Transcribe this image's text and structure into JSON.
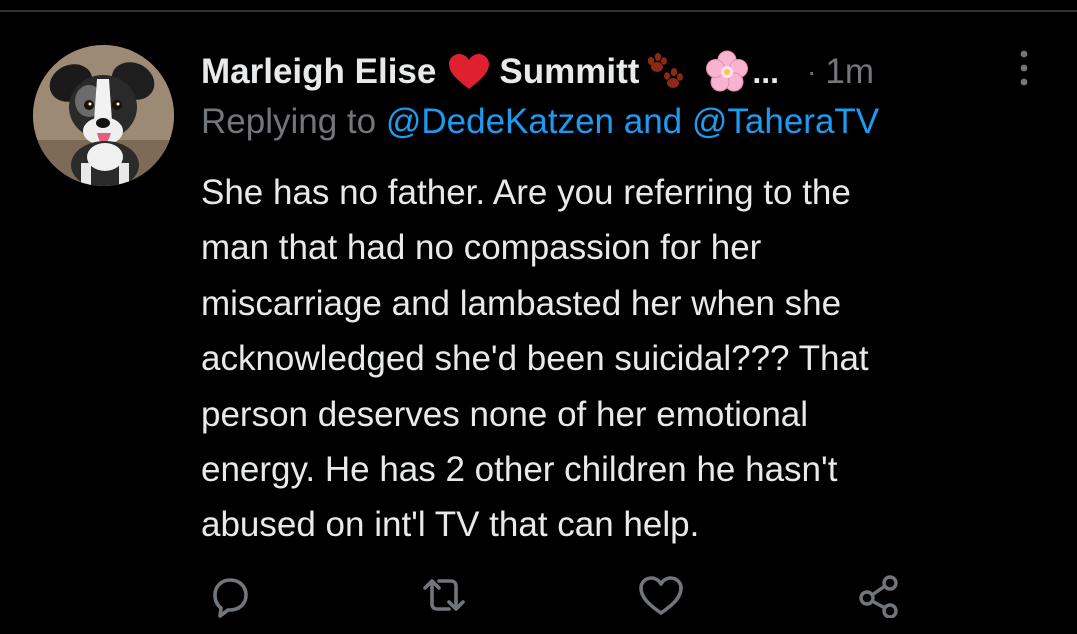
{
  "tweet": {
    "author": {
      "name_part1": "Marleigh Elise",
      "name_part2": "Summitt",
      "ellipsis": "...",
      "avatar_icon": "dog-avatar"
    },
    "time": "1m",
    "time_separator": "·",
    "replying": {
      "prefix": "Replying to ",
      "handle1": "@DedeKatzen",
      "conjunction": " and ",
      "handle2": "@TaheraTV"
    },
    "body_lines": [
      "She has no father. Are you referring to the",
      "man that had no compassion for her",
      "miscarriage and lambasted her when she",
      "acknowledged she'd been suicidal??? That",
      "person deserves none of her emotional",
      "energy. He has 2 other children he hasn't",
      "abused on int'l TV that can help."
    ],
    "actions": [
      {
        "icon": "reply-icon"
      },
      {
        "icon": "retweet-icon"
      },
      {
        "icon": "like-icon"
      },
      {
        "icon": "share-icon"
      }
    ]
  },
  "colors": {
    "background": "#000000",
    "text_primary": "#e7e9ea",
    "text_secondary": "#71767b",
    "link": "#1d9bf0",
    "heart": "#f91880",
    "paw": "#8b2a14",
    "flower": "#f4a6c6"
  }
}
